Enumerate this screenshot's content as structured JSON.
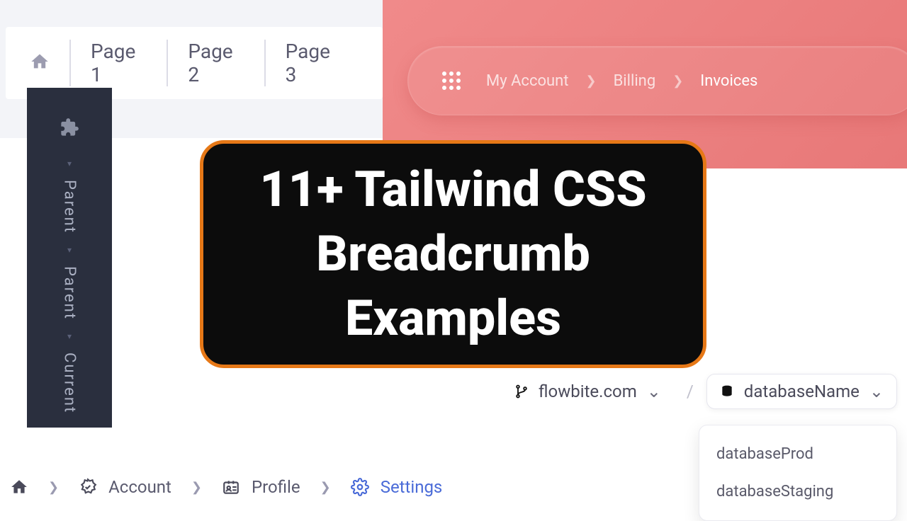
{
  "bc1": {
    "items": [
      "Page 1",
      "Page 2",
      "Page 3"
    ]
  },
  "pink": {
    "items": [
      "My Account",
      "Billing",
      "Invoices"
    ]
  },
  "vertical": {
    "items": [
      "Parent",
      "Parent",
      "Current"
    ]
  },
  "center": {
    "title": "11+ Tailwind CSS Breadcrumb Examples"
  },
  "db": {
    "domain": "flowbite.com",
    "name": "databaseName",
    "options": [
      "databaseProd",
      "databaseStaging"
    ]
  },
  "bottom": {
    "items": [
      "Account",
      "Profile",
      "Settings"
    ]
  }
}
